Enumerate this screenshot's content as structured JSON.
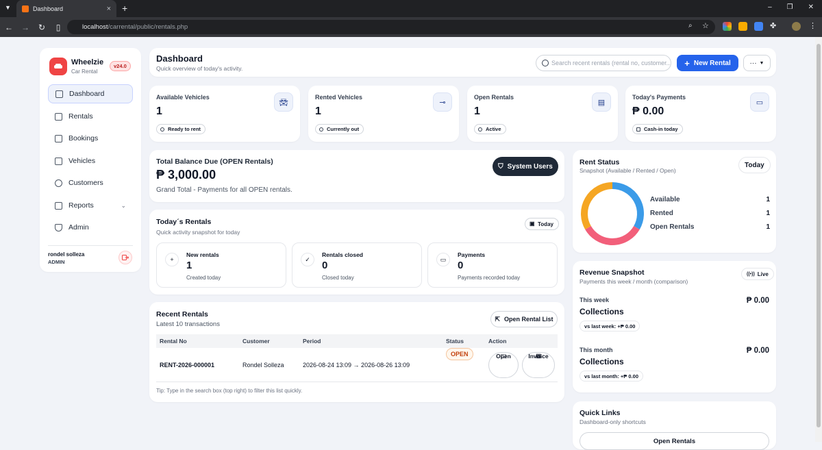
{
  "browser": {
    "tab_title": "Dashboard",
    "url_host": "localhost",
    "url_path": "/carrental/public/rentals.php"
  },
  "colors": {
    "accent": "#2563eb",
    "brand": "#ef4444",
    "available": "#3b9be8",
    "rented": "#f25f7a",
    "open": "#f5a623"
  },
  "sidebar": {
    "brand_name": "Wheelzie",
    "brand_sub": "Car Rental",
    "version": "v24.0",
    "items": [
      {
        "label": "Dashboard",
        "icon": "dashboard-icon"
      },
      {
        "label": "Rentals",
        "icon": "rentals-icon"
      },
      {
        "label": "Bookings",
        "icon": "calendar-icon"
      },
      {
        "label": "Vehicles",
        "icon": "bus-icon"
      },
      {
        "label": "Customers",
        "icon": "users-icon"
      },
      {
        "label": "Reports",
        "icon": "chart-icon"
      },
      {
        "label": "Admin",
        "icon": "shield-icon"
      }
    ],
    "user_name": "rondel solleza",
    "user_role": "ADMIN"
  },
  "header": {
    "title": "Dashboard",
    "subtitle": "Quick overview of today's activity.",
    "search_placeholder": "Search recent rentals (rental no, customer...",
    "new_rental": "New Rental",
    "more": "···"
  },
  "stats": [
    {
      "label": "Available Vehicles",
      "value": "1",
      "pill": "Ready to rent"
    },
    {
      "label": "Rented Vehicles",
      "value": "1",
      "pill": "Currently out"
    },
    {
      "label": "Open Rentals",
      "value": "1",
      "pill": "Active"
    },
    {
      "label": "Today's Payments",
      "value": "₱ 0.00",
      "pill": "Cash-in today"
    }
  ],
  "balance": {
    "label": "Total Balance Due (OPEN Rentals)",
    "value": "₱ 3,000.00",
    "sub": "Grand Total - Payments for all OPEN rentals.",
    "system_users": "System Users"
  },
  "today": {
    "title": "Today´s Rentals",
    "subtitle": "Quick activity snapshot for today",
    "badge": "Today",
    "cards": [
      {
        "label": "New rentals",
        "value": "1",
        "sub": "Created today"
      },
      {
        "label": "Rentals closed",
        "value": "0",
        "sub": "Closed today"
      },
      {
        "label": "Payments",
        "value": "0",
        "sub": "Payments recorded today"
      }
    ]
  },
  "recent": {
    "title": "Recent Rentals",
    "subtitle": "Latest 10 transactions",
    "open_list": "Open Rental List",
    "columns": [
      "Rental No",
      "Customer",
      "Period",
      "Status",
      "Action"
    ],
    "rows": [
      {
        "rental_no": "RENT-2026-000001",
        "customer": "Rondel Solleza",
        "period": "2026-08-24 13:09 → 2026-08-26 13:09",
        "status": "OPEN",
        "open": "Open",
        "invoice": "Invoice"
      }
    ],
    "tip": "Tip: Type in the search box (top right) to filter this list quickly."
  },
  "rent_status": {
    "title": "Rent Status",
    "subtitle": "Snapshot (Available / Rented / Open)",
    "badge": "Today",
    "items": [
      {
        "label": "Available",
        "value": 1
      },
      {
        "label": "Rented",
        "value": 1
      },
      {
        "label": "Open Rentals",
        "value": 1
      }
    ]
  },
  "revenue": {
    "title": "Revenue Snapshot",
    "subtitle": "Payments this week / month (comparison)",
    "badge": "Live",
    "week_label": "This week",
    "week_coll": "Collections",
    "week_amount": "₱ 0.00",
    "week_cmp": "vs last week: +₱ 0.00",
    "month_label": "This month",
    "month_coll": "Collections",
    "month_amount": "₱ 0.00",
    "month_cmp": "vs last month: +₱ 0.00"
  },
  "quick": {
    "title": "Quick Links",
    "subtitle": "Dashboard-only shortcuts",
    "first": "Open Rentals"
  }
}
